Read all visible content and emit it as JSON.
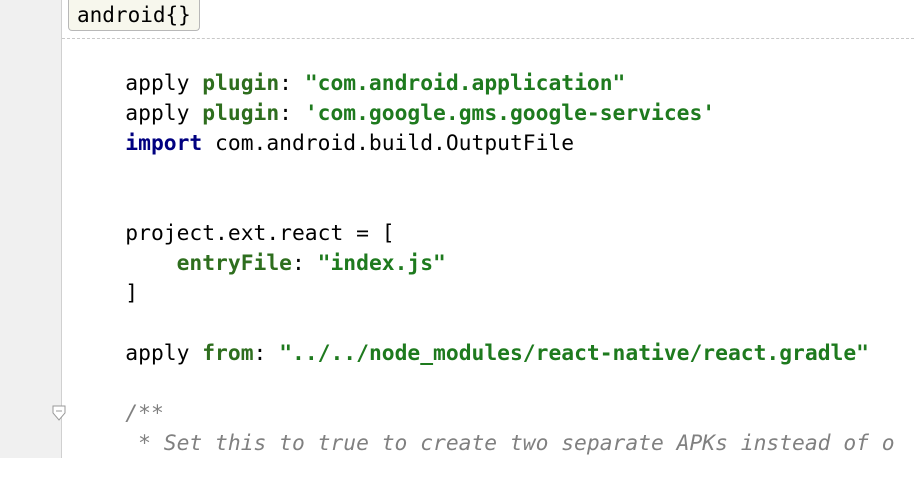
{
  "breadcrumb": {
    "label": "android{}"
  },
  "code": {
    "l1": {
      "t1": "apply ",
      "t2": "plugin",
      "t3": ": ",
      "t4": "\"com.android.application\""
    },
    "l2": {
      "t1": "apply ",
      "t2": "plugin",
      "t3": ": ",
      "t4": "'com.google.gms.google-services'"
    },
    "l3": {
      "t1": "import",
      "t2": " com.android.build.OutputFile"
    },
    "l6": {
      "t1": "project.ext.react = ["
    },
    "l7": {
      "t1": "    ",
      "t2": "entryFile",
      "t3": ": ",
      "t4": "\"index.js\""
    },
    "l8": {
      "t1": "]"
    },
    "l10": {
      "t1": "apply ",
      "t2": "from",
      "t3": ": ",
      "t4": "\"../../node_modules/react-native/react.gradle\""
    },
    "l12": {
      "t1": "/**"
    },
    "l13": {
      "t1": " * Set this to true to create two separate APKs instead of o"
    }
  }
}
